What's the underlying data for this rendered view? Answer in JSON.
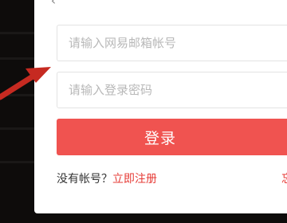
{
  "login_form": {
    "email_placeholder": "请输入网易邮箱帐号",
    "password_placeholder": "请输入登录密码",
    "submit_label": "登录",
    "no_account_text": "没有帐号？",
    "register_link": "立即注册",
    "right_link_partial": "忘"
  },
  "icons": {
    "back": "chevron-left-icon",
    "annotation": "red-arrow-icon"
  },
  "colors": {
    "primary_button": "#f05350",
    "link": "#e63b36",
    "annotation_arrow": "#c62a21",
    "background": "#0e0c0b"
  }
}
